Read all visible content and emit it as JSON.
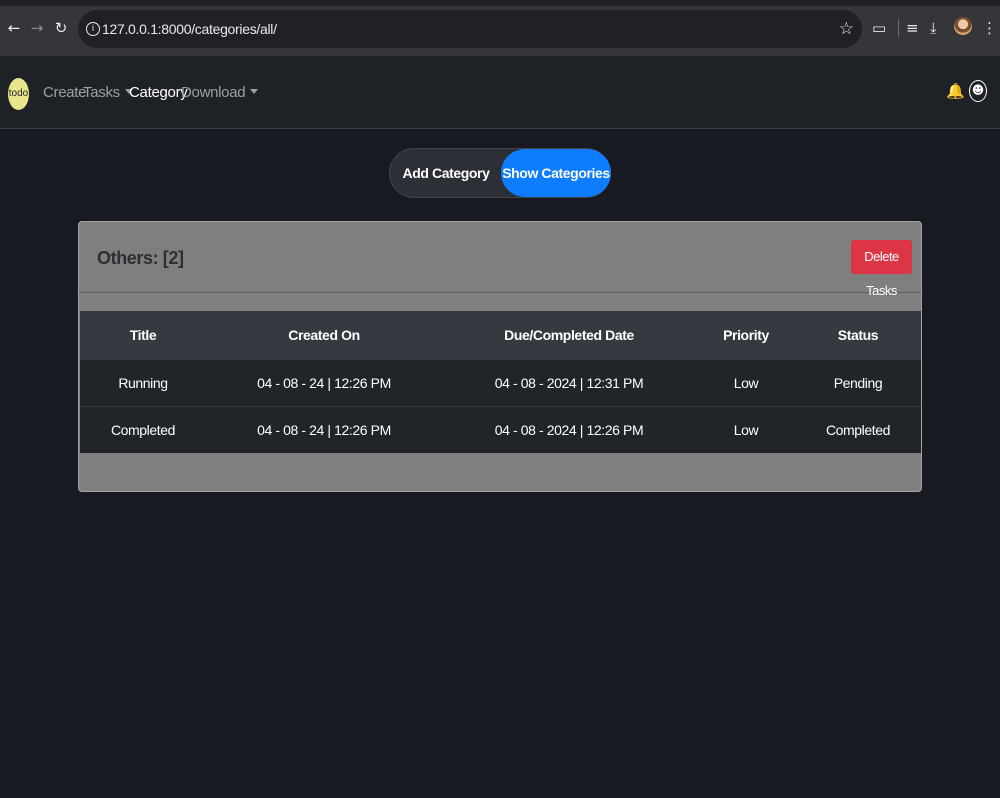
{
  "browser": {
    "url": "127.0.0.1:8000/categories/all/"
  },
  "navbar": {
    "logo_text": "todo",
    "links": [
      {
        "label": "Create"
      },
      {
        "label": "Tasks"
      },
      {
        "label": "Category"
      },
      {
        "label": "Download"
      }
    ]
  },
  "toggle": {
    "add_label": "Add Category",
    "show_label": "Show Categories"
  },
  "card": {
    "title": "Others: [2]",
    "delete_label": "Delete Tasks"
  },
  "table": {
    "headers": [
      "Title",
      "Created On",
      "Due/Completed Date",
      "Priority",
      "Status"
    ],
    "rows": [
      [
        "Running",
        "04 - 08 - 24 | 12:26 PM",
        "04 - 08 - 2024 | 12:31 PM",
        "Low",
        "Pending"
      ],
      [
        "Completed",
        "04 - 08 - 24 | 12:26 PM",
        "04 - 08 - 2024 | 12:26 PM",
        "Low",
        "Completed"
      ]
    ]
  },
  "colors": {
    "accent": "#0d7cff",
    "danger": "#dc3545",
    "logo": "#e7e68a"
  },
  "icons": [
    "back-icon",
    "forward-icon",
    "reload-icon",
    "site-info-icon",
    "bookmark-star-icon",
    "extensions-icon",
    "reading-list-icon",
    "download-icon",
    "profile-avatar",
    "menu-icon",
    "bell-icon",
    "user-icon"
  ]
}
